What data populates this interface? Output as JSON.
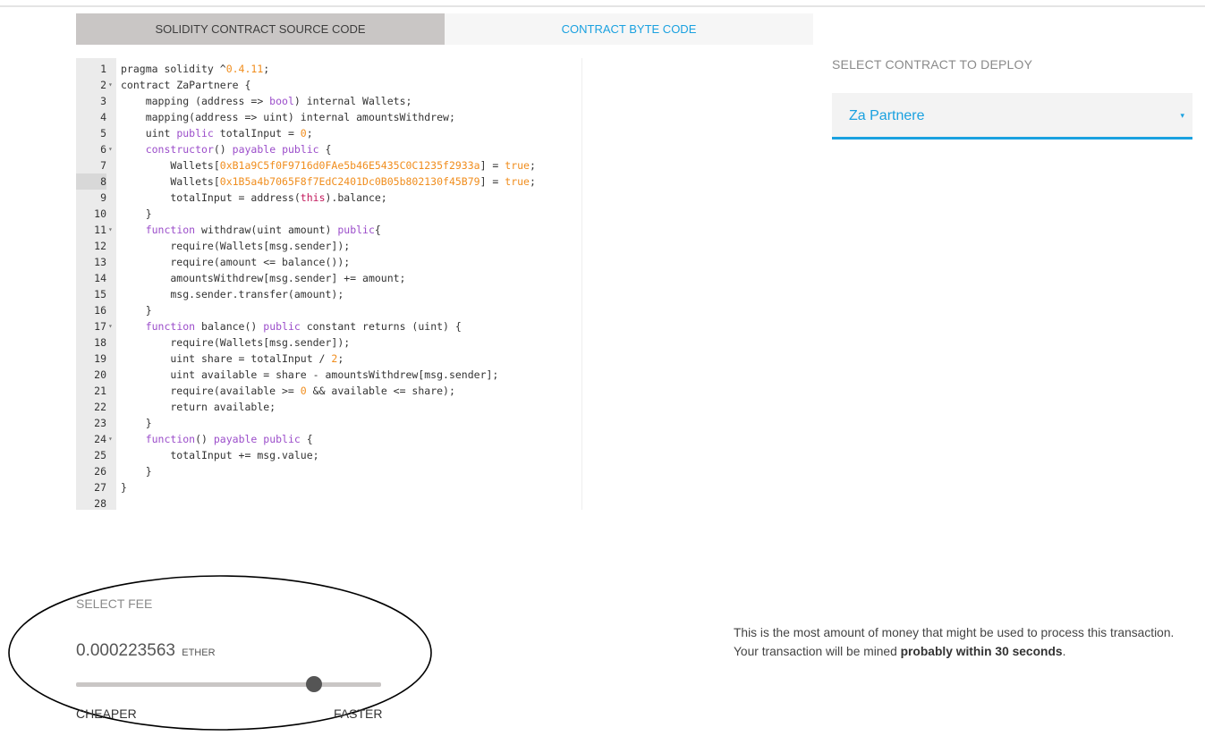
{
  "tabs": [
    {
      "label": "SOLIDITY CONTRACT SOURCE CODE",
      "active": true
    },
    {
      "label": "CONTRACT BYTE CODE",
      "active": false
    }
  ],
  "editor": {
    "active_line": 8,
    "lines": [
      {
        "n": "1",
        "text": "pragma solidity ^0.4.11;",
        "fold": false
      },
      {
        "n": "2",
        "text": "contract ZaPartnere {",
        "fold": true
      },
      {
        "n": "3",
        "text": "    mapping (address => bool) internal Wallets;",
        "fold": false
      },
      {
        "n": "4",
        "text": "    mapping(address => uint) internal amountsWithdrew;",
        "fold": false
      },
      {
        "n": "5",
        "text": "    uint public totalInput = 0;",
        "fold": false
      },
      {
        "n": "6",
        "text": "    constructor() payable public {",
        "fold": true
      },
      {
        "n": "7",
        "text": "        Wallets[0xB1a9C5f0F9716d0FAe5b46E5435C0C1235f2933a] = true;",
        "fold": false
      },
      {
        "n": "8",
        "text": "        Wallets[0x1B5a4b7065F8f7EdC2401Dc0B05b802130f45B79] = true;",
        "fold": false
      },
      {
        "n": "9",
        "text": "        totalInput = address(this).balance;",
        "fold": false
      },
      {
        "n": "10",
        "text": "    }",
        "fold": false
      },
      {
        "n": "11",
        "text": "    function withdraw(uint amount) public{",
        "fold": true
      },
      {
        "n": "12",
        "text": "        require(Wallets[msg.sender]);",
        "fold": false
      },
      {
        "n": "13",
        "text": "        require(amount <= balance());",
        "fold": false
      },
      {
        "n": "14",
        "text": "        amountsWithdrew[msg.sender] += amount;",
        "fold": false
      },
      {
        "n": "15",
        "text": "        msg.sender.transfer(amount);",
        "fold": false
      },
      {
        "n": "16",
        "text": "    }",
        "fold": false
      },
      {
        "n": "17",
        "text": "    function balance() public constant returns (uint) {",
        "fold": true
      },
      {
        "n": "18",
        "text": "        require(Wallets[msg.sender]);",
        "fold": false
      },
      {
        "n": "19",
        "text": "        uint share = totalInput / 2;",
        "fold": false
      },
      {
        "n": "20",
        "text": "        uint available = share - amountsWithdrew[msg.sender];",
        "fold": false
      },
      {
        "n": "21",
        "text": "        require(available >= 0 && available <= share);",
        "fold": false
      },
      {
        "n": "22",
        "text": "        return available;",
        "fold": false
      },
      {
        "n": "23",
        "text": "    }",
        "fold": false
      },
      {
        "n": "24",
        "text": "    function() payable public {",
        "fold": true
      },
      {
        "n": "25",
        "text": "        totalInput += msg.value;",
        "fold": false
      },
      {
        "n": "26",
        "text": "    }",
        "fold": false
      },
      {
        "n": "27",
        "text": "}",
        "fold": false
      },
      {
        "n": "28",
        "text": "",
        "fold": false
      }
    ]
  },
  "deploy": {
    "label": "SELECT CONTRACT TO DEPLOY",
    "selected": "Za Partnere",
    "caret": "▾"
  },
  "fee": {
    "label": "SELECT FEE",
    "value": "0.000223563",
    "unit": "ETHER",
    "slider_position": 0.78,
    "cheaper_label": "CHEAPER",
    "faster_label": "FASTER",
    "info_line1": "This is the most amount of money that might be used to process this transaction.",
    "info_line2_prefix": "Your transaction will be mined ",
    "info_line2_bold": "probably within 30 seconds",
    "info_line2_suffix": "."
  },
  "colors": {
    "accent": "#1aa1e0",
    "tab_inactive_bg": "#c9c6c5",
    "keyword": "#9b4dca",
    "number": "#f08d1d"
  }
}
